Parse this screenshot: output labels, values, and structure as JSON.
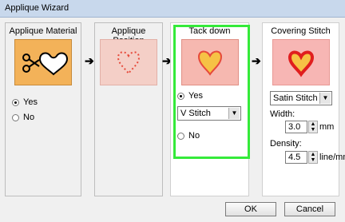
{
  "window": {
    "title": "Applique Wizard"
  },
  "steps": [
    {
      "title": "Applique Material",
      "icon": "scissors-heart-icon"
    },
    {
      "title": "Applique Position",
      "icon": "dotted-heart-icon"
    },
    {
      "title": "Tack down",
      "icon": "tack-down-heart-icon"
    },
    {
      "title": "Covering Stitch",
      "icon": "satin-heart-icon"
    }
  ],
  "material": {
    "yes_label": "Yes",
    "no_label": "No",
    "selected": "Yes"
  },
  "tackdown": {
    "yes_label": "Yes",
    "no_label": "No",
    "selected": "Yes",
    "stitch_value": "V Stitch"
  },
  "covering": {
    "stitch_value": "Satin Stitch",
    "width_label": "Width:",
    "width_value": "3.0",
    "width_unit": "mm",
    "density_label": "Density:",
    "density_value": "4.5",
    "density_unit": "line/mm"
  },
  "buttons": {
    "ok": "OK",
    "cancel": "Cancel"
  },
  "colors": {
    "highlight": "#35ea3a",
    "material_bg": "#f3b259",
    "position_bg": "#f4cfc7",
    "tackdown_bg": "#f6b8b0",
    "covering_bg": "#f7b6b4"
  }
}
